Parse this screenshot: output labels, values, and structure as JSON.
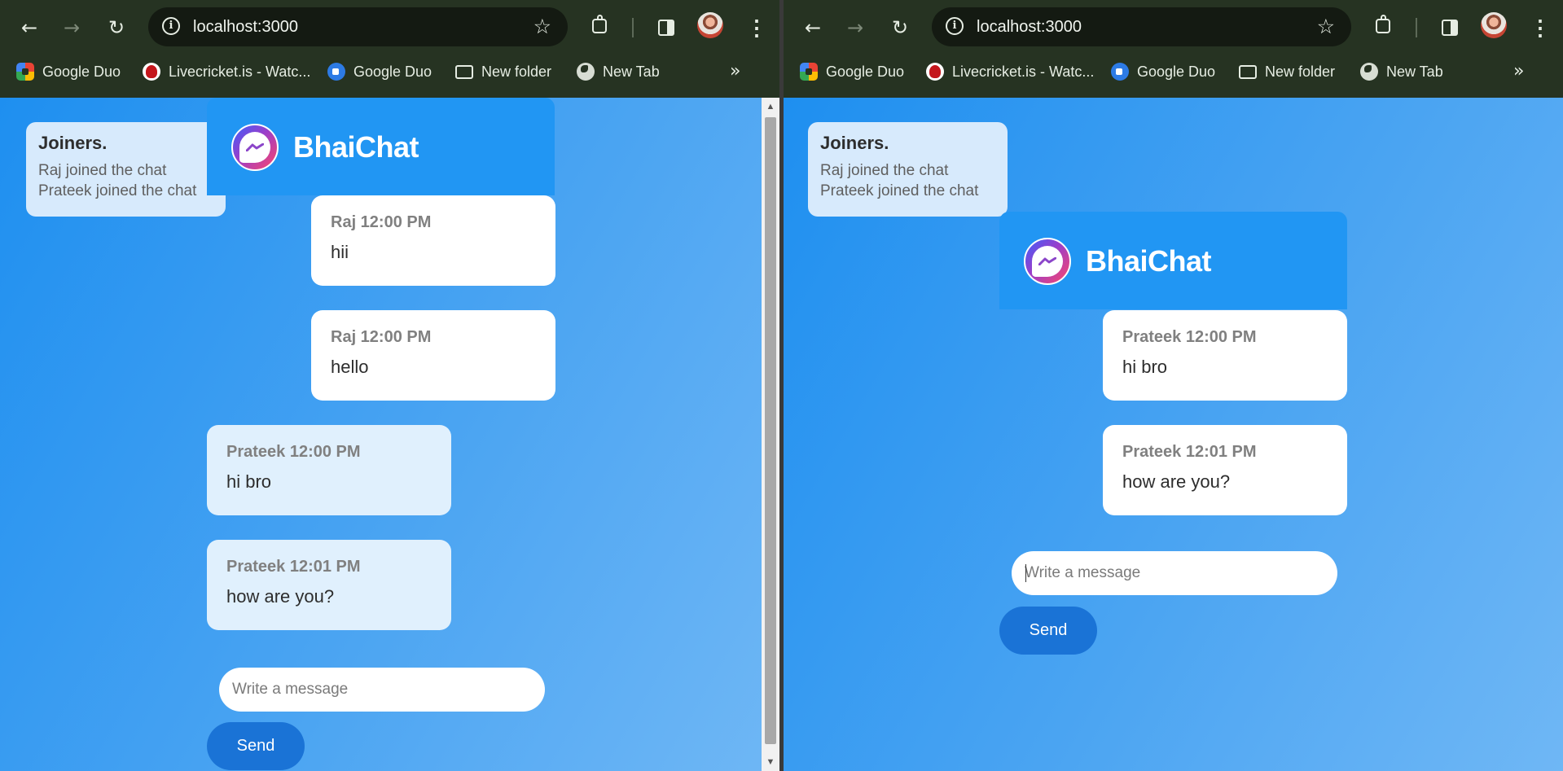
{
  "browser": {
    "url": "localhost:3000",
    "bookmarks": [
      {
        "label": "Google Duo",
        "icon": "google-duo-icon"
      },
      {
        "label": "Livecricket.is - Watc...",
        "icon": "livecricket-icon"
      },
      {
        "label": "Google Duo",
        "icon": "video-camera-icon"
      },
      {
        "label": "New folder",
        "icon": "folder-icon"
      },
      {
        "label": "New Tab",
        "icon": "globe-icon"
      }
    ],
    "more_bookmarks": "»"
  },
  "app": {
    "title": "BhaiChat",
    "joiners_title": "Joiners.",
    "joiners": [
      "Raj joined the chat",
      "Prateek joined the chat"
    ],
    "input_placeholder": "Write a message",
    "send_label": "Send"
  },
  "left_window": {
    "messages": [
      {
        "meta": "Raj 12:00 PM",
        "text": "hii",
        "own": true
      },
      {
        "meta": "Raj 12:00 PM",
        "text": "hello",
        "own": true
      },
      {
        "meta": "Prateek 12:00 PM",
        "text": "hi bro",
        "own": false
      },
      {
        "meta": "Prateek 12:01 PM",
        "text": "how are you?",
        "own": false
      }
    ]
  },
  "right_window": {
    "messages": [
      {
        "meta": "Prateek 12:00 PM",
        "text": "hi bro",
        "own": true
      },
      {
        "meta": "Prateek 12:01 PM",
        "text": "how are you?",
        "own": true
      }
    ]
  },
  "colors": {
    "browser_frame": "#263322",
    "header": "#2196f3",
    "send_button": "#1a73d6",
    "own_bubble": "#ffffff",
    "other_bubble": "#e0f0fd",
    "joiners_panel": "#d7eafc"
  }
}
